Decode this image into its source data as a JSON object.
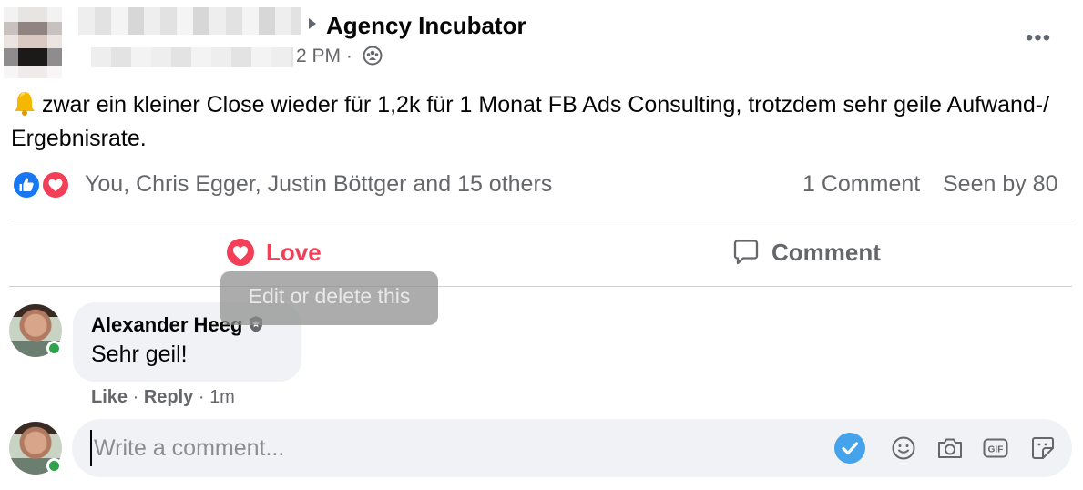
{
  "post": {
    "group_name": "Agency Incubator",
    "time_fragment": "2 PM ·",
    "text": "zwar ein kleiner Close wieder für 1,2k für 1 Monat FB Ads Consulting, trotzdem sehr geile Aufwand-/ Ergebnisrate.",
    "more_label": "•••"
  },
  "reactions": {
    "names": "You, Chris Egger, Justin Böttger and 15 others",
    "comment_count": "1 Comment",
    "seen_by": "Seen by 80"
  },
  "actions": {
    "love_label": "Love",
    "comment_label": "Comment"
  },
  "tooltip": {
    "text": "Edit or delete this"
  },
  "comment": {
    "author": "Alexander Heeg",
    "text": "Sehr geil!",
    "like_label": "Like",
    "separator": " · ",
    "reply_label": "Reply",
    "time": "1m"
  },
  "composer": {
    "placeholder": "Write a comment..."
  },
  "colors": {
    "love": "#f33e58",
    "like_blue": "#1877f2",
    "secondary_text": "#65676b",
    "bubble_bg": "#f0f2f5",
    "online_green": "#31a24c"
  }
}
